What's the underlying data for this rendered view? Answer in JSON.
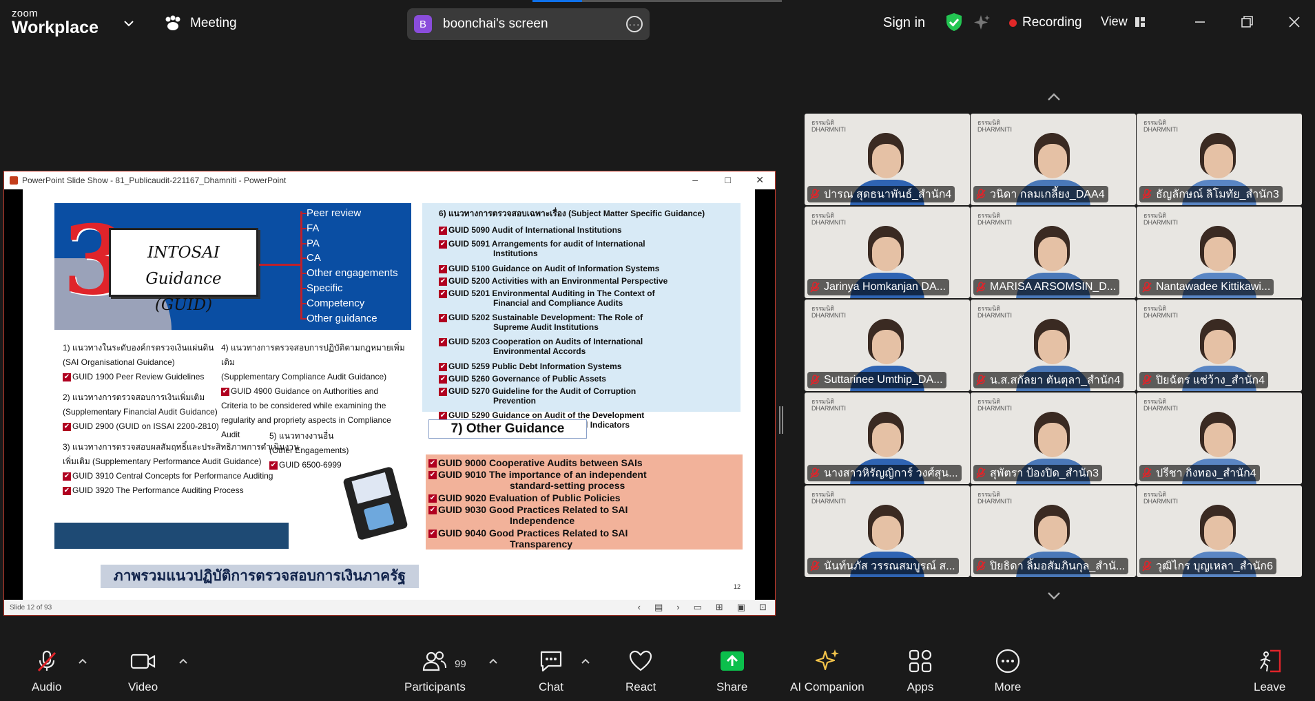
{
  "app": {
    "brand_top": "zoom",
    "brand_bottom": "Workplace"
  },
  "header": {
    "meeting_label": "Meeting",
    "screen_share": {
      "initial": "B",
      "name": "boonchai's screen"
    },
    "sign_in": "Sign in",
    "recording": "Recording",
    "view": "View"
  },
  "ppt": {
    "title": "PowerPoint Slide Show  -  81_Publicaudit-221167_Dhamniti - PowerPoint",
    "status": "Slide 12 of 93",
    "slide_number": "12"
  },
  "slide": {
    "guid_card_line1": "INTOSAI Guidance",
    "guid_card_line2": "(GUID)",
    "categories": [
      "Peer review",
      "FA",
      "PA",
      "CA",
      "Other engagements",
      "Specific",
      "Competency",
      "Other guidance"
    ],
    "left": {
      "s1_title": "1) แนวทางในระดับองค์กรตรวจเงินแผ่นดิน",
      "s1_sub": "(SAI Organisational Guidance)",
      "s1_item": "GUID 1900 Peer Review Guidelines",
      "s2_title": "2) แนวทางการตรวจสอบการเงินเพิ่มเติม",
      "s2_sub": "(Supplementary Financial Audit Guidance)",
      "s2_item": "GUID 2900 (GUID on ISSAI 2200-2810)",
      "s3_title": "3) แนวทางการตรวจสอบผลสัมฤทธิ์และประสิทธิภาพการดำเนินงาน",
      "s3_sub": "เพิ่มเติม (Supplementary Performance Audit Guidance)",
      "s3_item1": "GUID 3910 Central Concepts for Performance Auditing",
      "s3_item2": "GUID 3920 The Performance Auditing Process",
      "s4_title": "4) แนวทางการตรวจสอบการปฏิบัติตามกฎหมายเพิ่มเติม",
      "s4_sub": "(Supplementary Compliance Audit Guidance)",
      "s4_item_l1": "GUID 4900 Guidance on Authorities and",
      "s4_item_l2": "Criteria to be considered while examining the",
      "s4_item_l3": "regularity and propriety aspects in Compliance",
      "s4_item_l4": "Audit",
      "s5_title": "5) แนวทางงานอื่น",
      "s5_sub": "(Other Engagements)",
      "s5_item": "GUID 6500-6999"
    },
    "subject_heading": "6) แนวทางการตรวจสอบเฉพาะเรื่อง (Subject Matter Specific Guidance)",
    "subject_items": [
      {
        "code": "GUID 5090",
        "text": "Audit of International Institutions",
        "cont": ""
      },
      {
        "code": "GUID 5091",
        "text": "Arrangements for audit of International",
        "cont": "Institutions"
      },
      {
        "code": "GUID 5100",
        "text": "Guidance on Audit of Information Systems",
        "cont": ""
      },
      {
        "code": "GUID 5200",
        "text": "Activities with an Environmental Perspective",
        "cont": ""
      },
      {
        "code": "GUID 5201",
        "text": "Environmental Auditing in The Context of",
        "cont": "Financial and Compliance Audits"
      },
      {
        "code": "GUID 5202",
        "text": "Sustainable Development: The Role of",
        "cont": "Supreme Audit Institutions"
      },
      {
        "code": "GUID 5203",
        "text": "Cooperation on Audits of International",
        "cont": "Environmental Accords"
      },
      {
        "code": "GUID 5259",
        "text": "Public Debt Information Systems",
        "cont": ""
      },
      {
        "code": "GUID 5260",
        "text": "Governance of Public Assets",
        "cont": ""
      },
      {
        "code": "GUID 5270",
        "text": "Guideline for the Audit of Corruption",
        "cont": "Prevention"
      },
      {
        "code": "GUID 5290",
        "text": "Guidance on Audit of the Development",
        "cont": "and Use of Key National Indicators"
      }
    ],
    "other_heading": "7) Other Guidance",
    "other_items": [
      {
        "code": "GUID 9000",
        "text": "Cooperative Audits between SAIs",
        "cont": ""
      },
      {
        "code": "GUID 9010",
        "text": "The importance of an independent",
        "cont": "standard-setting process"
      },
      {
        "code": "GUID 9020",
        "text": "Evaluation of Public Policies",
        "cont": ""
      },
      {
        "code": "GUID 9030",
        "text": "Good Practices Related to SAI",
        "cont": "Independence"
      },
      {
        "code": "GUID 9040",
        "text": "Good Practices Related to SAI",
        "cont": "Transparency"
      }
    ],
    "footer_title": "ภาพรวมแนวปฏิบัติการตรวจสอบการเงินภาครัฐ"
  },
  "gallery": {
    "brand_line1": "ธรรมนิติ",
    "brand_line2": "DHARMNITI",
    "participants": [
      "ปารณ สุดธนาพันธ์_สำนัก4",
      "วนิดา กลมเกลี้ยง_DAA4",
      "ธัญลักษณ์ ลิโมทัย_สำนัก3",
      "Jarinya Homkanjan DA...",
      "MARISA ARSOMSIN_D...",
      "Nantawadee Kittikawi...",
      "Suttarinee Umthip_DA...",
      "น.ส.สกัลยา ตันตุลา_สำนัก4",
      "ปิยฉัตร แซ่ว้าง_สำนัก4",
      "นางสาวหิรัญญิการ์ วงศ์สุน...",
      "สุพัตรา   ป้องปิด_สำนัก3",
      "ปรีชา กิงทอง_สำนัก4",
      "นันท์นภัส วรรณสมบูรณ์ ส...",
      "ปิยธิดา ลิ้มอสัมภินกุล_สำนั...",
      "วุฒิไกร บุญเหลา_สำนัก6"
    ]
  },
  "toolbar": {
    "audio": "Audio",
    "video": "Video",
    "participants": "Participants",
    "participant_count": "99",
    "chat": "Chat",
    "react": "React",
    "share": "Share",
    "ai_companion": "AI Companion",
    "apps": "Apps",
    "more": "More",
    "leave": "Leave"
  },
  "colors": {
    "accent_blue": "#0e71eb",
    "share_green": "#0cbf4c",
    "recording_red": "#e02828",
    "shield_green": "#23c552",
    "ai_gold": "#f3c34a",
    "mic_muted_red": "#e0242a"
  }
}
